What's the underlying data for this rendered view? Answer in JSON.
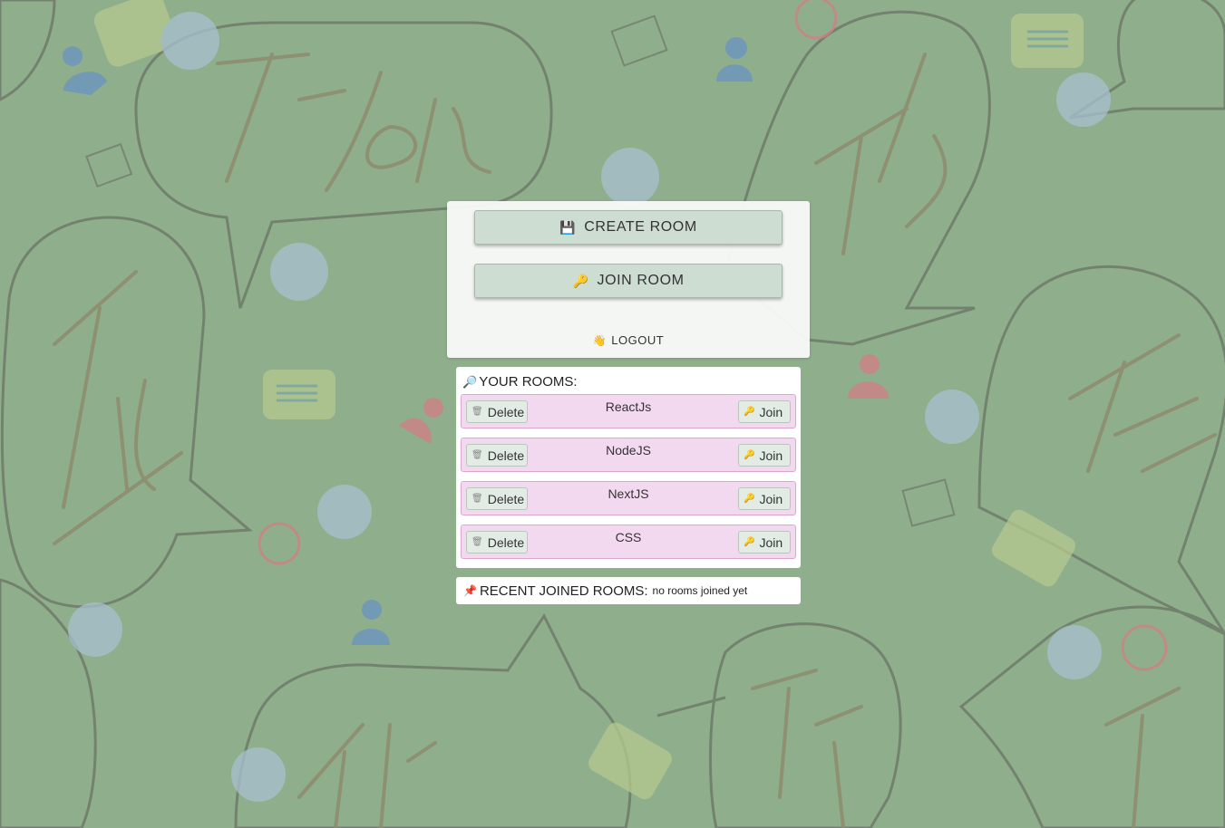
{
  "colors": {
    "background": "#8fae8c",
    "button_bg": "#cdddd1",
    "room_row_bg": "#f3d9ef",
    "room_row_border": "#d9a9d4"
  },
  "background": {
    "watermark_text": "T-Talk"
  },
  "main_menu": {
    "create_room": {
      "icon": "floppy-disk-icon",
      "glyph": "💾",
      "label": "CREATE ROOM"
    },
    "join_room": {
      "icon": "key-icon",
      "glyph": "🔑",
      "label": "JOIN ROOM"
    },
    "logout": {
      "icon": "waving-hand-icon",
      "glyph": "👋",
      "label": "LOGOUT"
    }
  },
  "your_rooms": {
    "icon": "magnifier-icon",
    "glyph": "🔎",
    "title": "YOUR ROOMS:",
    "delete_label": "Delete",
    "delete_glyph": "🗑",
    "join_label": "Join",
    "join_glyph": "🔑",
    "rooms": [
      {
        "name": "ReactJs"
      },
      {
        "name": "NodeJS"
      },
      {
        "name": "NextJS"
      },
      {
        "name": "CSS"
      }
    ]
  },
  "recent_rooms": {
    "icon": "pushpin-icon",
    "glyph": "📌",
    "title": "RECENT JOINED ROOMS:",
    "empty_text": "no rooms joined yet"
  }
}
